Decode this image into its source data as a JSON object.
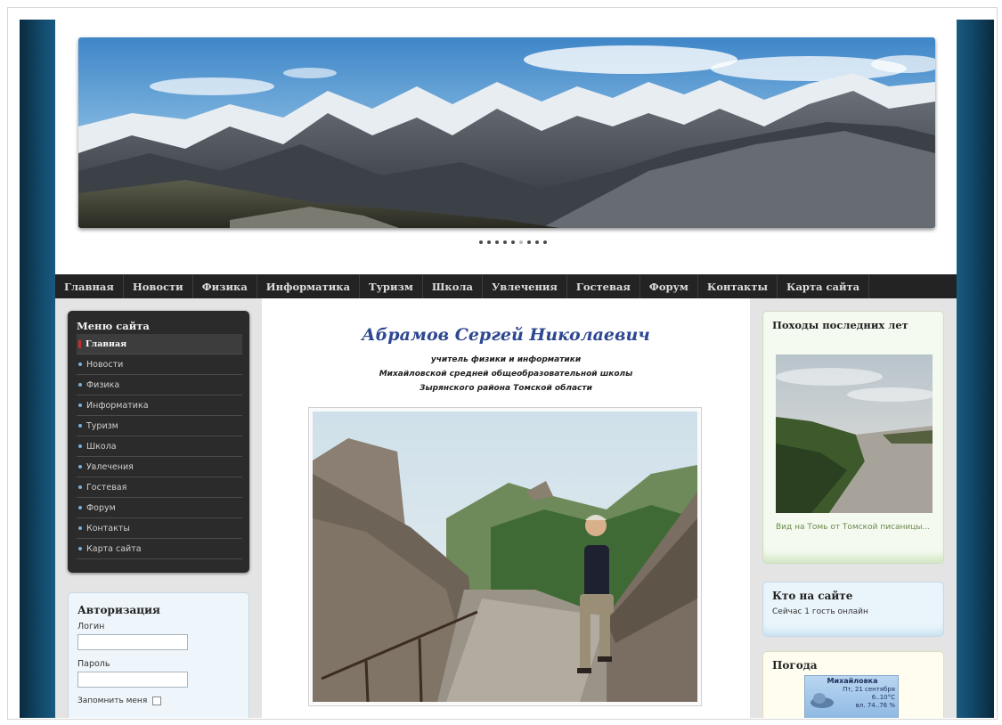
{
  "slider": {
    "dot_count": 9,
    "active_index": 5
  },
  "topnav": {
    "items": [
      "Главная",
      "Новости",
      "Физика",
      "Информатика",
      "Туризм",
      "Школа",
      "Увлечения",
      "Гостевая",
      "Форум",
      "Контакты",
      "Карта сайта"
    ]
  },
  "site_menu": {
    "title": "Меню сайта",
    "items": [
      "Главная",
      "Новости",
      "Физика",
      "Информатика",
      "Туризм",
      "Школа",
      "Увлечения",
      "Гостевая",
      "Форум",
      "Контакты",
      "Карта сайта"
    ],
    "active_index": 0
  },
  "login": {
    "title": "Авторизация",
    "login_label": "Логин",
    "password_label": "Пароль",
    "remember_label": "Запомнить меня"
  },
  "author": {
    "name": "Абрамов Сергей Николаевич",
    "line1": "учитель физики и информатики",
    "line2": "Михайловской средней общеобразовательной школы",
    "line3": "Зырянского района Томской области"
  },
  "hikes": {
    "title": "Походы последних лет",
    "caption": "Вид на Томь от Томской писаницы..."
  },
  "online": {
    "title": "Кто на сайте",
    "text": "Сейчас 1 гость онлайн"
  },
  "weather": {
    "title": "Погода",
    "city": "Михайловка",
    "date": "Пт, 21 сентября",
    "temp": "6..10°C",
    "pressure": "вл. 74..76 %"
  },
  "colors": {
    "nav_bg": "#232323",
    "author_name": "#2d4790",
    "frame_blue": "#12496a"
  }
}
